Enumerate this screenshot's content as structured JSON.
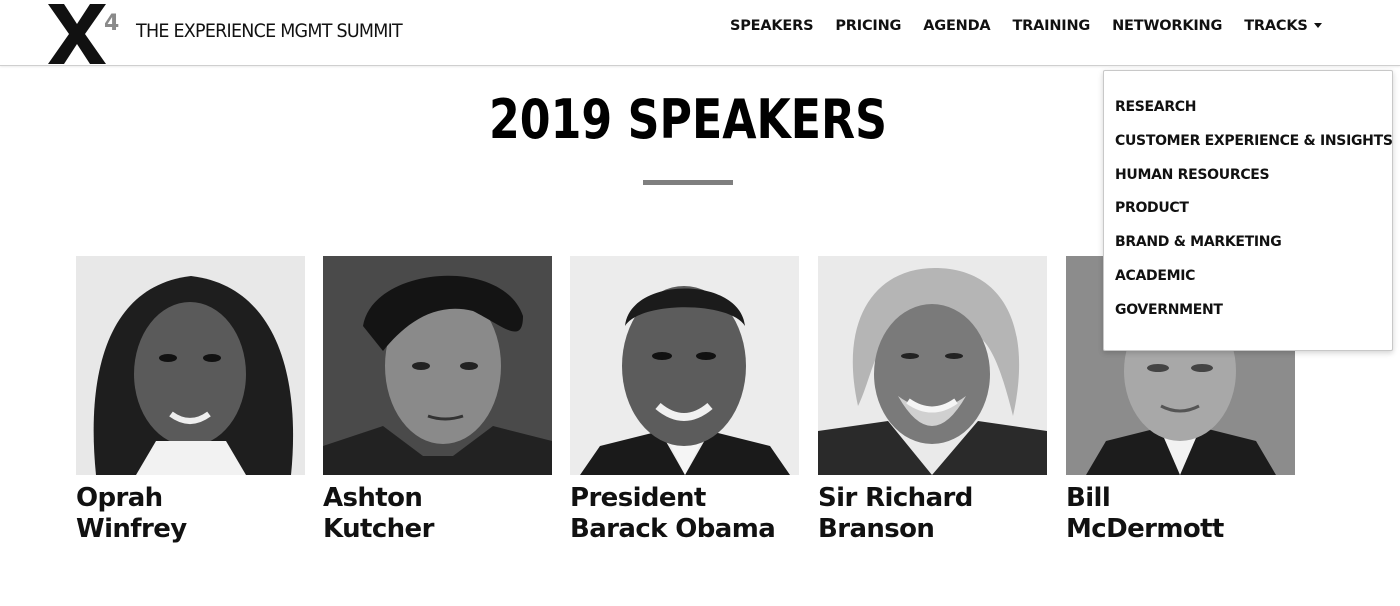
{
  "header": {
    "logo_letter": "X",
    "logo_superscript": "4",
    "brand": "THE EXPERIENCE MGMT SUMMIT"
  },
  "nav": {
    "items": [
      {
        "label": "SPEAKERS"
      },
      {
        "label": "PRICING"
      },
      {
        "label": "AGENDA"
      },
      {
        "label": "TRAINING"
      },
      {
        "label": "NETWORKING"
      },
      {
        "label": "TRACKS"
      }
    ]
  },
  "dropdown": {
    "items": [
      {
        "label": "RESEARCH"
      },
      {
        "label": "CUSTOMER EXPERIENCE & INSIGHTS"
      },
      {
        "label": "HUMAN RESOURCES"
      },
      {
        "label": "PRODUCT"
      },
      {
        "label": "BRAND & MARKETING"
      },
      {
        "label": "ACADEMIC"
      },
      {
        "label": "GOVERNMENT"
      }
    ]
  },
  "main": {
    "title": "2019 SPEAKERS"
  },
  "speakers": [
    {
      "line1": "Oprah",
      "line2": "Winfrey"
    },
    {
      "line1": "Ashton",
      "line2": "Kutcher"
    },
    {
      "line1": "President",
      "line2": "Barack Obama"
    },
    {
      "line1": "Sir Richard",
      "line2": "Branson"
    },
    {
      "line1": "Bill",
      "line2": "McDermott"
    }
  ],
  "colors": {
    "text": "#111111",
    "rule": "#7f7f7f",
    "background": "#ffffff"
  }
}
